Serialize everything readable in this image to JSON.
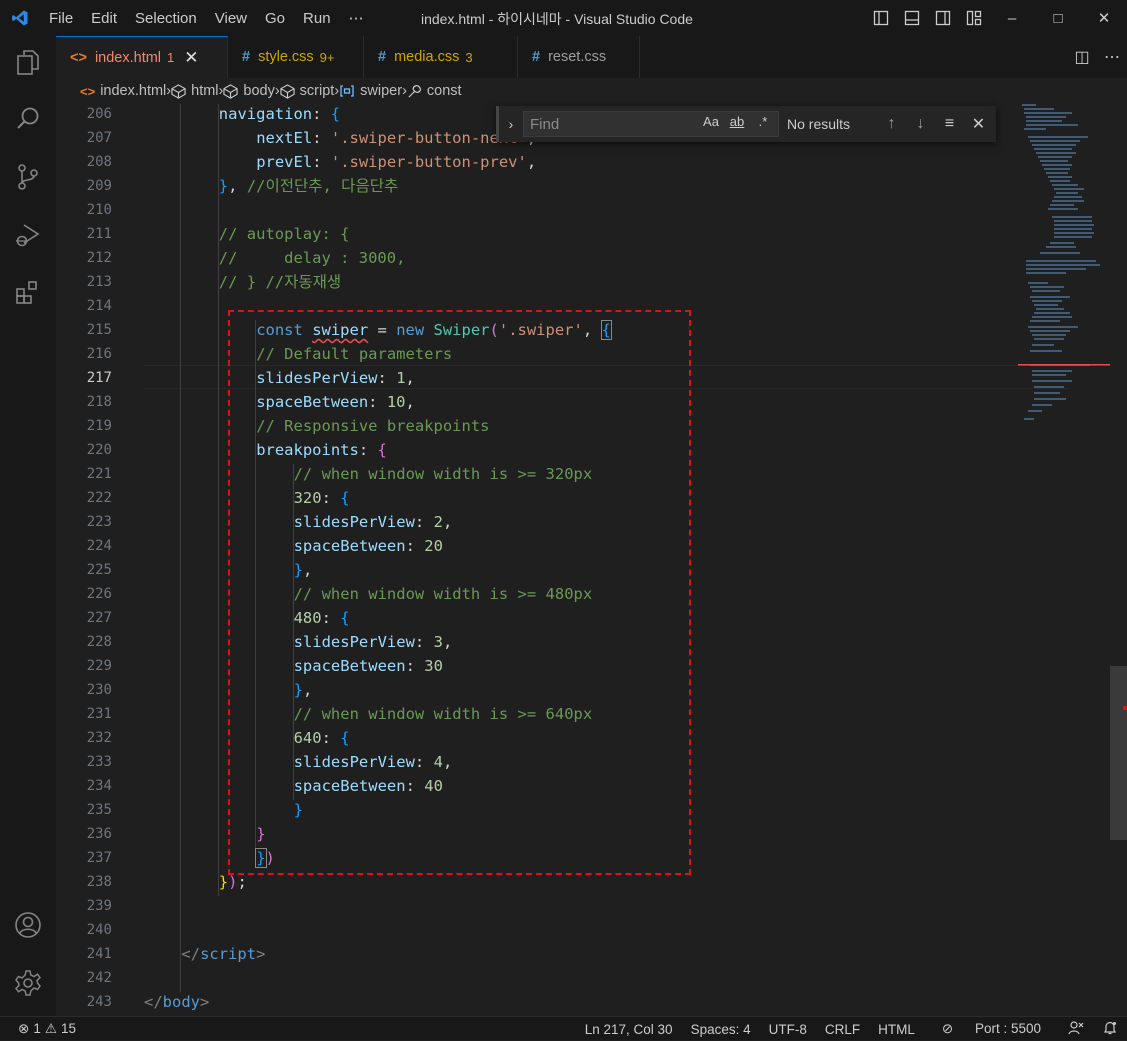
{
  "title_bar": {
    "menu": [
      "File",
      "Edit",
      "Selection",
      "View",
      "Go",
      "Run",
      "⋯"
    ],
    "window_title": "index.html - 하이시네마 - Visual Studio Code",
    "minimize": "–",
    "maximize": "□",
    "close": "✕"
  },
  "tabs": [
    {
      "icon": "<>",
      "label": "index.html",
      "count": "1",
      "close": "✕",
      "active": true,
      "color": "#f48771",
      "count_color": "#f48771"
    },
    {
      "icon": "#",
      "label": "style.css",
      "count": "9+",
      "active": false,
      "color": "#cca700",
      "count_color": "#cca700"
    },
    {
      "icon": "#",
      "label": "media.css",
      "count": "3",
      "active": false,
      "color": "#cca700",
      "count_color": "#cca700"
    },
    {
      "icon": "#",
      "label": "reset.css",
      "count": "",
      "active": false,
      "color": "#9d9d9d",
      "count_color": "#9d9d9d"
    }
  ],
  "tab_actions": {
    "split": "◫",
    "more": "⋯"
  },
  "breadcrumb": [
    "index.html",
    "html",
    "body",
    "script",
    "swiper",
    "const"
  ],
  "find_widget": {
    "toggle": "›",
    "placeholder": "Find",
    "match_case": "Aa",
    "whole_word": "ab",
    "regex": ".*",
    "result": "No results",
    "prev": "↑",
    "next": "↓",
    "selection": "≡",
    "close": "✕"
  },
  "line_numbers": [
    "206",
    "207",
    "208",
    "209",
    "210",
    "211",
    "212",
    "213",
    "214",
    "215",
    "216",
    "217",
    "218",
    "219",
    "220",
    "221",
    "222",
    "223",
    "224",
    "225",
    "226",
    "227",
    "228",
    "229",
    "230",
    "231",
    "232",
    "233",
    "234",
    "235",
    "236",
    "237",
    "238",
    "239",
    "240",
    "241",
    "242",
    "243"
  ],
  "current_line": "217",
  "code_lines": [
    {
      "indent": 8,
      "tokens": [
        [
          "prop",
          "navigation"
        ],
        [
          "pun",
          ": "
        ],
        [
          "br3",
          "{"
        ]
      ]
    },
    {
      "indent": 12,
      "tokens": [
        [
          "prop",
          "nextEl"
        ],
        [
          "pun",
          ": "
        ],
        [
          "str",
          "'.swiper-button-next'"
        ],
        [
          "pun",
          ","
        ]
      ]
    },
    {
      "indent": 12,
      "tokens": [
        [
          "prop",
          "prevEl"
        ],
        [
          "pun",
          ": "
        ],
        [
          "str",
          "'.swiper-button-prev'"
        ],
        [
          "pun",
          ","
        ]
      ]
    },
    {
      "indent": 8,
      "tokens": [
        [
          "br3",
          "}"
        ],
        [
          "pun",
          ", "
        ],
        [
          "cmt",
          "//이전단추, 다음단추"
        ]
      ]
    },
    {
      "indent": 0,
      "tokens": []
    },
    {
      "indent": 8,
      "tokens": [
        [
          "cmt",
          "// autoplay: {"
        ]
      ]
    },
    {
      "indent": 8,
      "tokens": [
        [
          "cmt",
          "//     delay : 3000,"
        ]
      ]
    },
    {
      "indent": 8,
      "tokens": [
        [
          "cmt",
          "// } //자동재생"
        ]
      ]
    },
    {
      "indent": 0,
      "tokens": []
    },
    {
      "indent": 12,
      "tokens": [
        [
          "kw",
          "const "
        ],
        [
          "var sq",
          "swiper"
        ],
        [
          "pun",
          " = "
        ],
        [
          "kw",
          "new "
        ],
        [
          "cls",
          "Swiper"
        ],
        [
          "br2",
          "("
        ],
        [
          "str",
          "'.swiper'"
        ],
        [
          "pun",
          ", "
        ],
        [
          "br3 match",
          "{"
        ]
      ]
    },
    {
      "indent": 12,
      "tokens": [
        [
          "cmt",
          "// Default parameters"
        ]
      ]
    },
    {
      "indent": 12,
      "tokens": [
        [
          "prop",
          "slidesPerView"
        ],
        [
          "pun",
          ": "
        ],
        [
          "num",
          "1"
        ],
        [
          "pun",
          ","
        ]
      ]
    },
    {
      "indent": 12,
      "tokens": [
        [
          "prop",
          "spaceBetween"
        ],
        [
          "pun",
          ": "
        ],
        [
          "num",
          "10"
        ],
        [
          "pun",
          ","
        ]
      ]
    },
    {
      "indent": 12,
      "tokens": [
        [
          "cmt",
          "// Responsive breakpoints"
        ]
      ]
    },
    {
      "indent": 12,
      "tokens": [
        [
          "prop",
          "breakpoints"
        ],
        [
          "pun",
          ": "
        ],
        [
          "br2",
          "{"
        ]
      ]
    },
    {
      "indent": 16,
      "tokens": [
        [
          "cmt",
          "// when window width is >= 320px"
        ]
      ]
    },
    {
      "indent": 16,
      "tokens": [
        [
          "num",
          "320"
        ],
        [
          "pun",
          ": "
        ],
        [
          "br3",
          "{"
        ]
      ]
    },
    {
      "indent": 16,
      "tokens": [
        [
          "prop",
          "slidesPerView"
        ],
        [
          "pun",
          ": "
        ],
        [
          "num",
          "2"
        ],
        [
          "pun",
          ","
        ]
      ]
    },
    {
      "indent": 16,
      "tokens": [
        [
          "prop",
          "spaceBetween"
        ],
        [
          "pun",
          ": "
        ],
        [
          "num",
          "20"
        ]
      ]
    },
    {
      "indent": 16,
      "tokens": [
        [
          "br3",
          "}"
        ],
        [
          "pun",
          ","
        ]
      ]
    },
    {
      "indent": 16,
      "tokens": [
        [
          "cmt",
          "// when window width is >= 480px"
        ]
      ]
    },
    {
      "indent": 16,
      "tokens": [
        [
          "num",
          "480"
        ],
        [
          "pun",
          ": "
        ],
        [
          "br3",
          "{"
        ]
      ]
    },
    {
      "indent": 16,
      "tokens": [
        [
          "prop",
          "slidesPerView"
        ],
        [
          "pun",
          ": "
        ],
        [
          "num",
          "3"
        ],
        [
          "pun",
          ","
        ]
      ]
    },
    {
      "indent": 16,
      "tokens": [
        [
          "prop",
          "spaceBetween"
        ],
        [
          "pun",
          ": "
        ],
        [
          "num",
          "30"
        ]
      ]
    },
    {
      "indent": 16,
      "tokens": [
        [
          "br3",
          "}"
        ],
        [
          "pun",
          ","
        ]
      ]
    },
    {
      "indent": 16,
      "tokens": [
        [
          "cmt",
          "// when window width is >= 640px"
        ]
      ]
    },
    {
      "indent": 16,
      "tokens": [
        [
          "num",
          "640"
        ],
        [
          "pun",
          ": "
        ],
        [
          "br3",
          "{"
        ]
      ]
    },
    {
      "indent": 16,
      "tokens": [
        [
          "prop",
          "slidesPerView"
        ],
        [
          "pun",
          ": "
        ],
        [
          "num",
          "4"
        ],
        [
          "pun",
          ","
        ]
      ]
    },
    {
      "indent": 16,
      "tokens": [
        [
          "prop",
          "spaceBetween"
        ],
        [
          "pun",
          ": "
        ],
        [
          "num",
          "40"
        ]
      ]
    },
    {
      "indent": 16,
      "tokens": [
        [
          "br3",
          "}"
        ]
      ]
    },
    {
      "indent": 12,
      "tokens": [
        [
          "br2",
          "}"
        ]
      ]
    },
    {
      "indent": 12,
      "tokens": [
        [
          "br3 match",
          "}"
        ],
        [
          "br2",
          ")"
        ]
      ]
    },
    {
      "indent": 8,
      "tokens": [
        [
          "br1",
          "}"
        ],
        [
          "br2",
          ")"
        ],
        [
          "pun",
          ";"
        ]
      ]
    },
    {
      "indent": 0,
      "tokens": []
    },
    {
      "indent": 0,
      "tokens": []
    },
    {
      "indent": 4,
      "tokens": [
        [
          "tagb",
          "</"
        ],
        [
          "tag",
          "script"
        ],
        [
          "tagb",
          ">"
        ]
      ]
    },
    {
      "indent": 0,
      "tokens": []
    },
    {
      "indent": 0,
      "tokens": [
        [
          "tagb",
          "</"
        ],
        [
          "tag",
          "body"
        ],
        [
          "tagb",
          ">"
        ]
      ]
    }
  ],
  "status_bar": {
    "errors": "1",
    "warnings": "15",
    "position": "Ln 217, Col 30",
    "spaces": "Spaces: 4",
    "encoding": "UTF-8",
    "eol": "CRLF",
    "language": "HTML",
    "port": "Port : 5500"
  },
  "colors": {
    "accent": "#0078d4",
    "highlight_box": "#e0101a",
    "error": "#f14c4c"
  }
}
